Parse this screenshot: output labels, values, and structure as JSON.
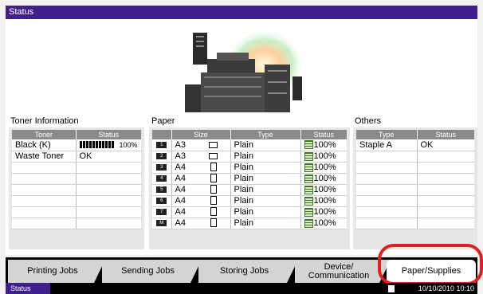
{
  "title": "Status",
  "toner": {
    "section_title": "Toner Information",
    "headers": [
      "Toner",
      "Status"
    ],
    "rows": [
      {
        "name": "Black (K)",
        "status_text": "100%",
        "level": 1.0
      },
      {
        "name": "Waste Toner",
        "status_text": "OK"
      }
    ]
  },
  "paper": {
    "section_title": "Paper",
    "headers": [
      "Size",
      "Type",
      "Status"
    ],
    "rows": [
      {
        "tray": "1",
        "size": "A3",
        "type": "Plain",
        "status": "100%",
        "orient": "landscape"
      },
      {
        "tray": "2",
        "size": "A3",
        "type": "Plain",
        "status": "100%",
        "orient": "landscape"
      },
      {
        "tray": "3",
        "size": "A4",
        "type": "Plain",
        "status": "100%",
        "orient": "portrait"
      },
      {
        "tray": "4",
        "size": "A4",
        "type": "Plain",
        "status": "100%",
        "orient": "portrait"
      },
      {
        "tray": "5",
        "size": "A4",
        "type": "Plain",
        "status": "100%",
        "orient": "portrait"
      },
      {
        "tray": "6",
        "size": "A4",
        "type": "Plain",
        "status": "100%",
        "orient": "portrait"
      },
      {
        "tray": "7",
        "size": "A4",
        "type": "Plain",
        "status": "100%",
        "orient": "portrait"
      },
      {
        "tray": "M",
        "size": "A4",
        "type": "Plain",
        "status": "100%",
        "orient": "portrait"
      }
    ]
  },
  "others": {
    "section_title": "Others",
    "headers": [
      "Type",
      "Status"
    ],
    "rows": [
      {
        "type": "Staple A",
        "status": "OK"
      }
    ]
  },
  "tabs": [
    {
      "label": "Printing Jobs"
    },
    {
      "label": "Sending Jobs"
    },
    {
      "label": "Storing Jobs"
    },
    {
      "label": "Device/ Communication"
    },
    {
      "label": "Paper/Supplies",
      "active": true
    }
  ],
  "statusbar": {
    "status_label": "Status",
    "datetime": "10/10/2010 10:10"
  }
}
